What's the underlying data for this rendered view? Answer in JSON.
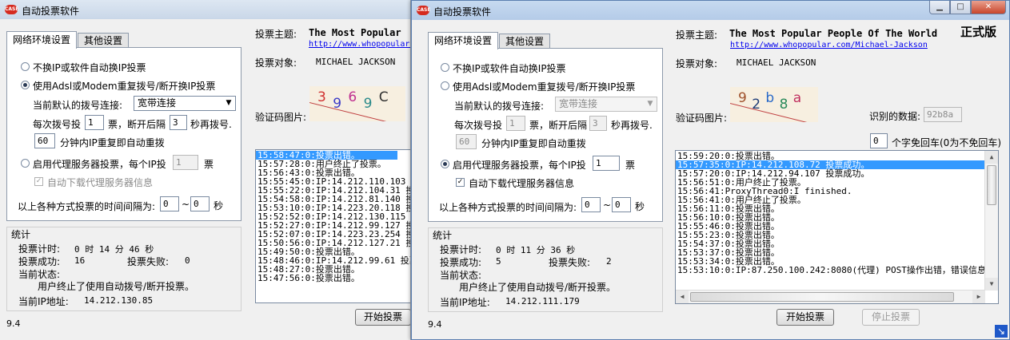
{
  "app": {
    "title": "自动投票软件",
    "icon_text": "CASE",
    "version": "9.4"
  },
  "tabs": [
    "网络环境设置",
    "其他设置"
  ],
  "network": {
    "opt_no_change": "不换IP或软件自动换IP投票",
    "opt_adsl": "使用Adsl或Modem重复拨号/断开换IP投票",
    "dial_label": "当前默认的拨号连接:",
    "dial_value": "宽带连接",
    "per_dial_1": "每次拨号投",
    "per_dial_2": "票，断开后隔",
    "per_dial_3": "秒再拨号.",
    "repeat_text": "分钟内IP重复即自动重拨",
    "opt_proxy_1": "启用代理服务器投票，每个IP投",
    "opt_proxy_2": "票",
    "auto_download_proxy": "自动下载代理服务器信息",
    "interval_label": "以上各种方式投票的时间间隔为:",
    "interval_tilde": "~",
    "interval_unit": "秒"
  },
  "stats": {
    "heading": "统计",
    "timer_label": "投票计时:",
    "success_label": "投票成功:",
    "fail_label": "投票失败:",
    "status_label": "当前状态:",
    "ip_label": "当前IP地址:"
  },
  "info": {
    "topic_label": "投票主题:",
    "topic_title": "The Most Popular People Of The World",
    "topic_url": "http://www.whopopular.com/Michael-Jackson",
    "topic_url_short": "http://www.whopopular.",
    "target_label": "投票对象:",
    "target_value": "MICHAEL JACKSON",
    "captcha_label": "验证码图片:",
    "recognized_label": "识别的数据:",
    "free_return_label": "个字免回车(0为不免回车)",
    "edition_badge": "正式版"
  },
  "buttons": {
    "start": "开始投票",
    "stop": "停止投票"
  },
  "left_window": {
    "topic_title_visible": "The Most Popular",
    "dial_count": "1",
    "dial_wait": "3",
    "repeat_minutes": "60",
    "proxy_per_ip": "1",
    "interval_from": "0",
    "interval_to": "0",
    "timer_value": "0 时 14 分 46 秒",
    "success_value": "16",
    "fail_value": "0",
    "status_value": "用户终止了使用自动拨号/断开投票。",
    "ip_value": "14.212.130.85",
    "captcha_chars": [
      "3",
      "9",
      "6",
      "9",
      "C"
    ],
    "captcha_colors": [
      "#d03030",
      "#3a3ac8",
      "#c03090",
      "#2a8a8a",
      "#303030"
    ],
    "log": [
      "15:58:47:0:投票出错。",
      "15:57:28:0:用户终止了投票。",
      "15:56:43:0:投票出错。",
      "15:55:45:0:IP:14.212.110.103 投票成功。",
      "15:55:22:0:IP:14.212.104.31 投票成功。",
      "15:54:58:0:IP:14.212.81.140 投票成功。",
      "15:53:10:0:IP:14.223.20.118 投票成功。",
      "15:52:52:0:IP:14.212.130.115 投票成功。",
      "15:52:27:0:IP:14.212.99.127 投票成功。",
      "15:52:07:0:IP:14.223.23.254 投票成功。",
      "15:50:56:0:IP:14.212.127.21 投票成功。",
      "15:49:50:0:投票出错。",
      "15:48:46:0:IP:14.212.99.61 投票成功。",
      "15:48:27:0:投票出错。",
      "15:47:56:0:投票出错。"
    ]
  },
  "right_window": {
    "dial_count": "1",
    "dial_wait": "3",
    "repeat_minutes": "60",
    "proxy_per_ip": "1",
    "interval_from": "0",
    "interval_to": "0",
    "recognized_value": "92b8a",
    "free_return_value": "0",
    "timer_value": "0 时 11 分 36 秒",
    "success_value": "5",
    "fail_value": "2",
    "status_value": "用户终止了使用自动拨号/断开投票。",
    "ip_value": "14.212.111.179",
    "captcha_chars": [
      "9",
      "2",
      "b",
      "8",
      "a"
    ],
    "captcha_colors": [
      "#a0522d",
      "#1e3c78",
      "#2a6ac8",
      "#2a8a5a",
      "#c03060"
    ],
    "log": [
      "15:59:20:0:投票出错。",
      "15:57:35:0:IP:14.212.108.72 投票成功。",
      "15:57:20:0:IP:14.212.94.107 投票成功。",
      "15:56:51:0:用户终止了投票。",
      "15:56:41:ProxyThread0:I finished.",
      "15:56:41:0:用户终止了投票。",
      "15:56:11:0:投票出错。",
      "15:56:10:0:投票出错。",
      "15:55:46:0:投票出错。",
      "15:55:23:0:投票出错。",
      "15:54:37:0:投票出错。",
      "15:53:37:0:投票出错。",
      "15:53:34:0:投票出错。",
      "15:53:10:0:IP:87.250.100.242:8080(代理) POST操作出错，错误信息："
    ]
  }
}
